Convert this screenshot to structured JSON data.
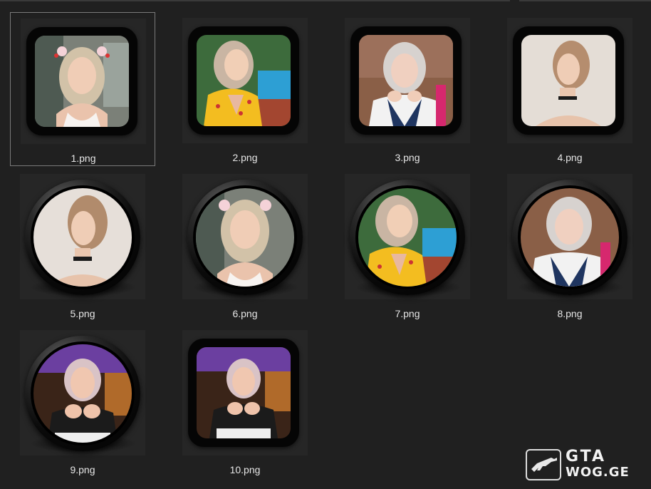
{
  "files": [
    {
      "name": "1.png",
      "selected": true
    },
    {
      "name": "2.png"
    },
    {
      "name": "3.png"
    },
    {
      "name": "4.png"
    },
    {
      "name": "5.png"
    },
    {
      "name": "6.png"
    },
    {
      "name": "7.png"
    },
    {
      "name": "8.png"
    },
    {
      "name": "9.png"
    },
    {
      "name": "10.png"
    }
  ],
  "watermark": {
    "line1": "GTA",
    "line2": "WOG.GE"
  },
  "colors": {
    "background": "#202020",
    "text": "#e6e6e6"
  }
}
